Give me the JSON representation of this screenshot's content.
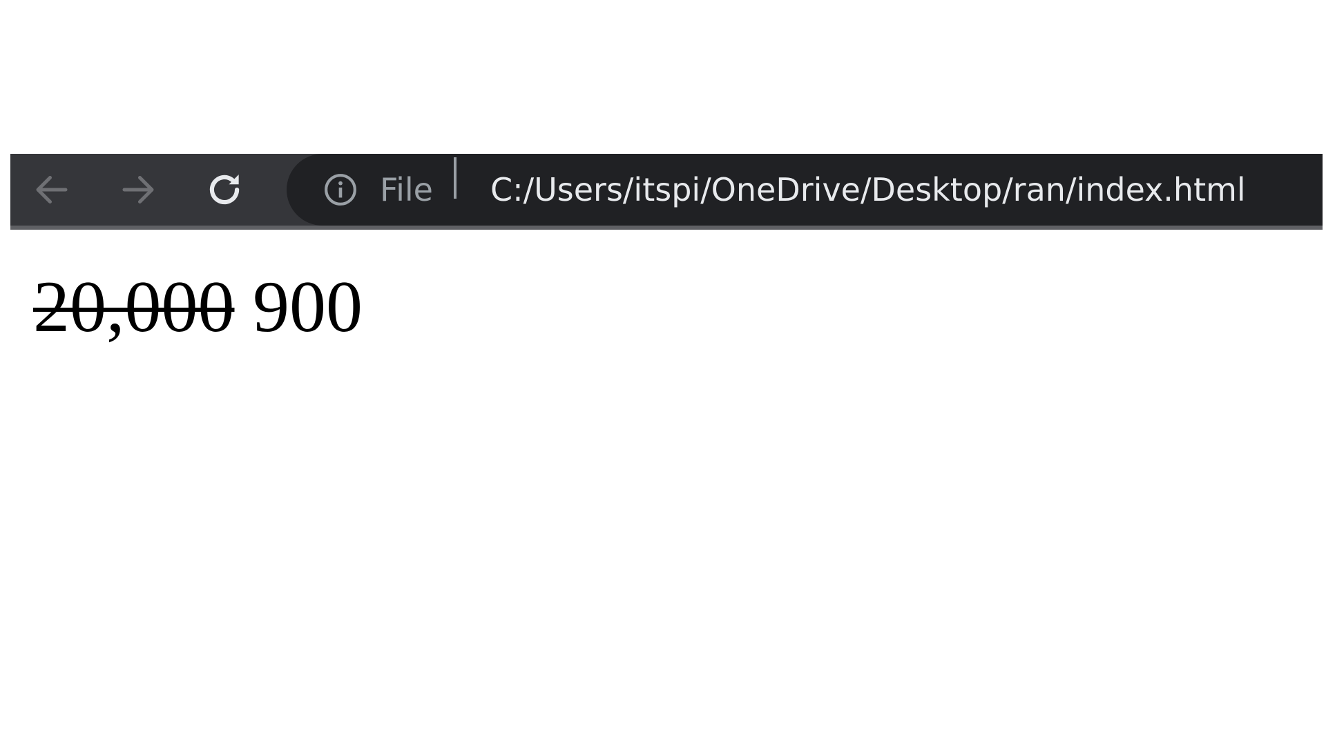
{
  "browser": {
    "toolbar": {
      "back_icon": "arrow-left-icon",
      "forward_icon": "arrow-right-icon",
      "reload_icon": "reload-icon"
    },
    "address_bar": {
      "security_icon": "info-icon",
      "scheme_label": "File",
      "url": "C:/Users/itspi/OneDrive/Desktop/ran/index.html"
    }
  },
  "page": {
    "old_price": "20,000",
    "new_price": "900"
  },
  "colors": {
    "toolbar_background": "#35363a",
    "omnibox_background": "#202124",
    "url_text": "#e8eaed",
    "muted_text": "#9aa0a6",
    "page_background": "#ffffff",
    "page_text": "#000000"
  }
}
